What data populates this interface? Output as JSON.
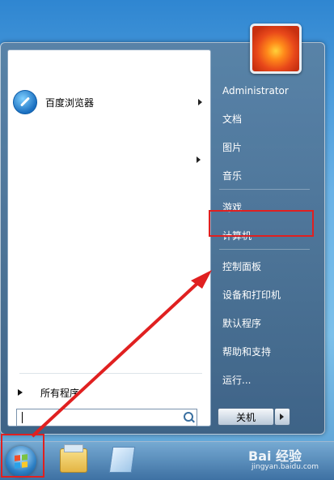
{
  "left_pane": {
    "pinned": [
      {
        "label": "百度浏览器",
        "icon": "baidu-browser-icon",
        "has_submenu": true
      }
    ],
    "all_programs_label": "所有程序",
    "search": {
      "placeholder": "",
      "value": ""
    }
  },
  "right_pane": {
    "user": "Administrator",
    "items": [
      "文档",
      "图片",
      "音乐",
      "游戏",
      "计算机",
      "控制面板",
      "设备和打印机",
      "默认程序",
      "帮助和支持",
      "运行..."
    ],
    "highlighted_item": "控制面板",
    "shutdown_label": "关机"
  },
  "taskbar": {
    "icons": [
      "start-orb-icon",
      "windows-explorer-icon",
      "notepad-icon"
    ]
  },
  "watermark": {
    "main": "Bai 经验",
    "sub": "jingyan.baidu.com"
  },
  "colors": {
    "highlight": "#e02020",
    "accent": "#2c7fc4"
  }
}
